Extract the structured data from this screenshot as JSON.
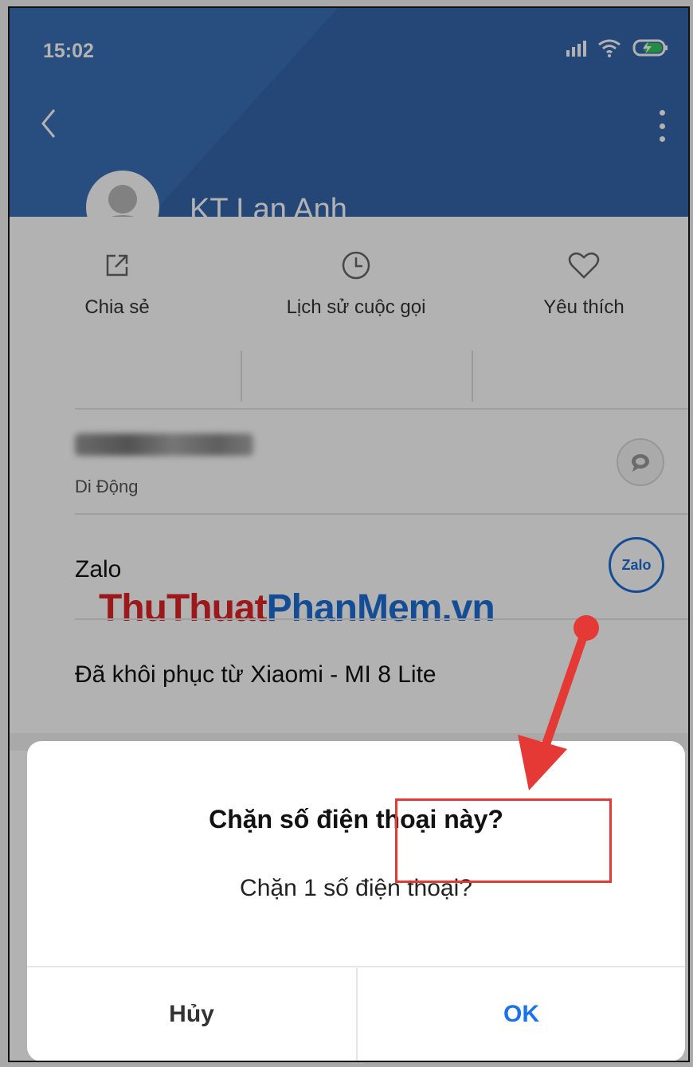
{
  "status_bar": {
    "time": "15:02"
  },
  "contact": {
    "name": "KT Lan Anh"
  },
  "actions": [
    {
      "label": "Chia sẻ",
      "icon": "share-icon"
    },
    {
      "label": "Lịch sử cuộc gọi",
      "icon": "clock-icon"
    },
    {
      "label": "Yêu thích",
      "icon": "heart-icon"
    }
  ],
  "phone_row": {
    "type_label": "Di Động"
  },
  "zalo_row": {
    "label": "Zalo",
    "badge": "Zalo"
  },
  "restored_row": {
    "label": "Đã khôi phục từ Xiaomi - MI 8 Lite"
  },
  "watermark": {
    "part1": "ThuThuat",
    "part2": "PhanMem",
    "part3": ".vn"
  },
  "dialog": {
    "title": "Chặn số điện thoại này?",
    "message": "Chặn 1 số điện thoại?",
    "cancel_label": "Hủy",
    "ok_label": "OK"
  },
  "colors": {
    "header_blue": "#3a6fb6",
    "ok_blue": "#1a73e8",
    "highlight_red": "#e53935"
  }
}
